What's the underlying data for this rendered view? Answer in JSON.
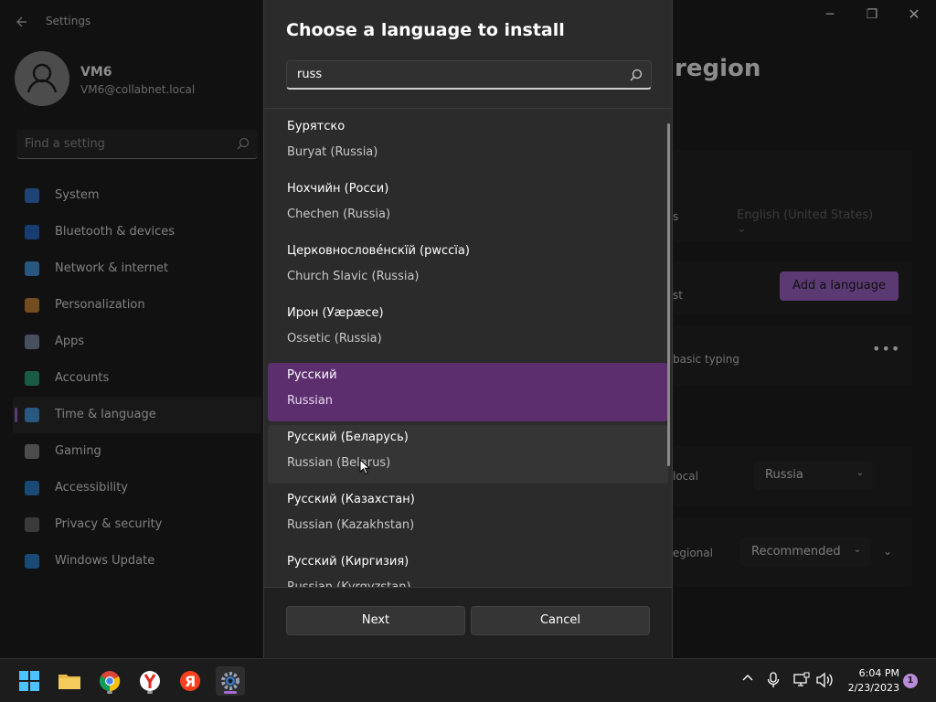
{
  "window": {
    "app_title": "Settings",
    "controls": {
      "minimize": "─",
      "maximize": "❐",
      "close": "✕"
    }
  },
  "user": {
    "name": "VM6",
    "email": "VM6@collabnet.local"
  },
  "search": {
    "placeholder": "Find a setting"
  },
  "nav": {
    "items": [
      {
        "label": "System",
        "icon": "system-icon",
        "color": "#3a7bd5"
      },
      {
        "label": "Bluetooth & devices",
        "icon": "bluetooth-icon",
        "color": "#2d6fd1"
      },
      {
        "label": "Network & internet",
        "icon": "network-icon",
        "color": "#4a9fe8"
      },
      {
        "label": "Personalization",
        "icon": "brush-icon",
        "color": "#d48a3c"
      },
      {
        "label": "Apps",
        "icon": "apps-icon",
        "color": "#8090a8"
      },
      {
        "label": "Accounts",
        "icon": "accounts-icon",
        "color": "#2fa87a"
      },
      {
        "label": "Time & language",
        "icon": "time-language-icon",
        "color": "#4a9fe8",
        "active": true
      },
      {
        "label": "Gaming",
        "icon": "gaming-icon",
        "color": "#8a8a8a"
      },
      {
        "label": "Accessibility",
        "icon": "accessibility-icon",
        "color": "#2f86d6"
      },
      {
        "label": "Privacy & security",
        "icon": "shield-icon",
        "color": "#6a6a6a"
      },
      {
        "label": "Windows Update",
        "icon": "update-icon",
        "color": "#2f86d6"
      }
    ]
  },
  "page": {
    "title_fragment": "region",
    "windows_display_language": "English (United States)",
    "add_language_label": "Add a language",
    "partial_texts": {
      "row1": "s",
      "row2": "st",
      "row3": "basic typing",
      "row4": "local",
      "row5": "egional"
    },
    "country": "Russia",
    "regional_format": "Recommended"
  },
  "dialog": {
    "title": "Choose a language to install",
    "search_value": "russ",
    "languages": [
      {
        "native": "Бурятско",
        "english": "Buryat (Russia)"
      },
      {
        "native": "Нохчийн (Росси)",
        "english": "Chechen (Russia)"
      },
      {
        "native": "Церковнословéнскïй (рwссïа)",
        "english": "Church Slavic (Russia)"
      },
      {
        "native": "Ирон (Уæрæсе)",
        "english": "Ossetic (Russia)"
      },
      {
        "native": "Русский",
        "english": "Russian",
        "selected": true
      },
      {
        "native": "Русский (Беларусь)",
        "english": "Russian (Belarus)",
        "hovered": true
      },
      {
        "native": "Русский (Казахстан)",
        "english": "Russian (Kazakhstan)"
      },
      {
        "native": "Русский (Киргизия)",
        "english": "Russian (Kyrgyzstan)"
      }
    ],
    "next_label": "Next",
    "cancel_label": "Cancel"
  },
  "taskbar": {
    "apps": [
      "start-icon",
      "file-explorer-icon",
      "chrome-icon",
      "yandex-browser-icon",
      "yandex-icon",
      "settings-icon"
    ],
    "tray": {
      "chevron": "^",
      "mic": "🎤",
      "network": "▭",
      "volume": "🔊"
    },
    "time": "6:04 PM",
    "date": "2/23/2023",
    "notifications": "1"
  },
  "accent_color": "#a66bd3",
  "selected_color": "#5c2e6e"
}
